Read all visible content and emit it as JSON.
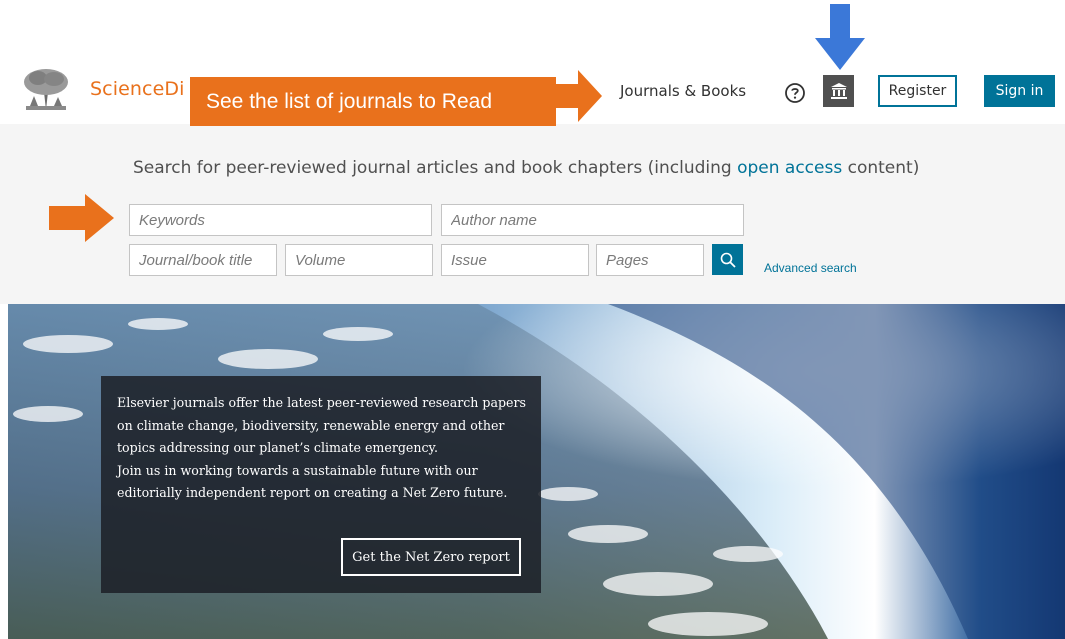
{
  "header": {
    "brand": "ScienceDi",
    "nav_link": "Journals & Books",
    "help_icon": "question-circle-icon",
    "institution_icon": "institution-building-icon",
    "register_label": "Register",
    "signin_label": "Sign in"
  },
  "annotations": {
    "callout_text": "See the list of journals to Read",
    "orange": "#e9711c",
    "blue": "#3b78d8"
  },
  "search": {
    "heading_pre": "Search for peer-reviewed journal articles and book chapters (including ",
    "heading_link": "open access",
    "heading_post": " content)",
    "keywords_placeholder": "Keywords",
    "author_placeholder": "Author name",
    "journal_placeholder": "Journal/book title",
    "volume_placeholder": "Volume",
    "issue_placeholder": "Issue",
    "pages_placeholder": "Pages",
    "search_icon": "search-icon",
    "advanced_label": "Advanced search"
  },
  "hero": {
    "lines": [
      "Elsevier journals offer the latest peer-reviewed research papers",
      "on climate change, biodiversity, renewable energy and other",
      "topics addressing our planet’s climate emergency.",
      "Join us in working towards a sustainable future with our",
      "editorially independent report on creating a Net Zero future."
    ],
    "cta_label": "Get the Net Zero report"
  },
  "colors": {
    "accent": "#007398",
    "brand": "#e9711c",
    "panel_bg": "#f5f5f5"
  }
}
